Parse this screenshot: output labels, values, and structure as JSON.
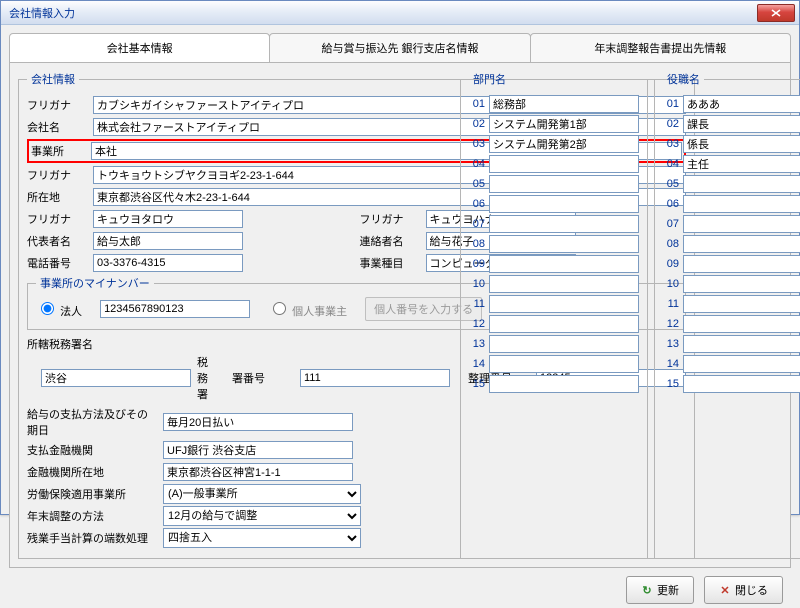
{
  "window": {
    "title": "会社情報入力"
  },
  "tabs": {
    "t1": "会社基本情報",
    "t2": "給与賞与振込先 銀行支店名情報",
    "t3": "年末調整報告書提出先情報"
  },
  "fieldset_labels": {
    "company": "会社情報",
    "mynumber": "事業所のマイナンバー",
    "dept": "部門名",
    "pos": "役職名"
  },
  "labels": {
    "furigana": "フリガナ",
    "company_name": "会社名",
    "office": "事業所",
    "address": "所在地",
    "rep": "代表者名",
    "contact": "連絡者名",
    "phone": "電話番号",
    "biz_type": "事業種目",
    "corp": "法人",
    "indiv": "個人事業主",
    "enter_pn": "個人番号を入力する",
    "tax_office": "所轄税務署名",
    "tax_suffix": "税務署",
    "office_no": "署番号",
    "serial_no": "整理番号",
    "pay_method": "給与の支払方法及びその期日",
    "bank": "支払金融機関",
    "bank_addr": "金融機関所在地",
    "labor_office": "労働保険適用事業所",
    "nencho": "年末調整の方法",
    "rounding": "残業手当計算の端数処理"
  },
  "values": {
    "kana": "カブシキガイシャファーストアイティプロ",
    "name": "株式会社ファーストアイティプロ",
    "office": "本社",
    "addr_kana": "トウキョウトシブヤクヨヨギ2-23-1-644",
    "addr": "東京都渋谷区代々木2-23-1-644",
    "rep_kana": "キュウヨタロウ",
    "rep": "給与太郎",
    "contact_kana": "キュウヨハナコ",
    "contact": "給与花子",
    "phone": "03-3376-4315",
    "biz": "コンピュータソフトウェア業",
    "mynumber": "1234567890123",
    "tax_office": "渋谷",
    "office_no": "111",
    "serial_no": "12345",
    "pay_method": "毎月20日払い",
    "bank": "UFJ銀行 渋谷支店",
    "bank_addr": "東京都渋谷区神宮1-1-1",
    "labor_office": "(A)一般事業所",
    "nencho": "12月の給与で調整",
    "rounding": "四捨五入"
  },
  "departments": [
    "総務部",
    "システム開発第1部",
    "システム開発第2部",
    "",
    "",
    "",
    "",
    "",
    "",
    "",
    "",
    "",
    "",
    "",
    ""
  ],
  "positions": [
    "あああ",
    "課長",
    "係長",
    "主任",
    "",
    "",
    "",
    "",
    "",
    "",
    "",
    "",
    "",
    "",
    ""
  ],
  "buttons": {
    "update": "更新",
    "close": "閉じる"
  }
}
